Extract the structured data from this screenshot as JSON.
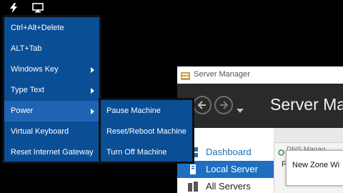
{
  "toolbar": {
    "icons": [
      "lightning-icon",
      "monitor-icon"
    ]
  },
  "menu": {
    "items": [
      {
        "label": "Ctrl+Alt+Delete",
        "has_submenu": false
      },
      {
        "label": "ALT+Tab",
        "has_submenu": false
      },
      {
        "label": "Windows Key",
        "has_submenu": true
      },
      {
        "label": "Type Text",
        "has_submenu": true
      },
      {
        "label": "Power",
        "has_submenu": true,
        "active": true
      },
      {
        "label": "Virtual Keyboard",
        "has_submenu": false
      },
      {
        "label": "Reset Internet Gateway",
        "has_submenu": false
      }
    ],
    "power_submenu": [
      {
        "label": "Pause Machine"
      },
      {
        "label": "Reset/Reboot Machine"
      },
      {
        "label": "Turn Off Machine"
      }
    ]
  },
  "server_manager": {
    "window_title": "Server Manager",
    "heading": "Server Ma",
    "sidebar": [
      {
        "label": "Dashboard",
        "icon": "dashboard-icon"
      },
      {
        "label": "Local Server",
        "icon": "local-server-icon",
        "selected": true
      },
      {
        "label": "All Servers",
        "icon": "all-servers-icon"
      }
    ],
    "dns_manager_label": "DNS Manag",
    "dns_letter": "F",
    "new_zone_title": "New Zone Wi",
    "new_zone_sub": "New Zone Wi"
  },
  "colors": {
    "menu_bg": "#0a4e96",
    "menu_active": "#1f64b4",
    "selection_blue": "#1e6fc0"
  }
}
